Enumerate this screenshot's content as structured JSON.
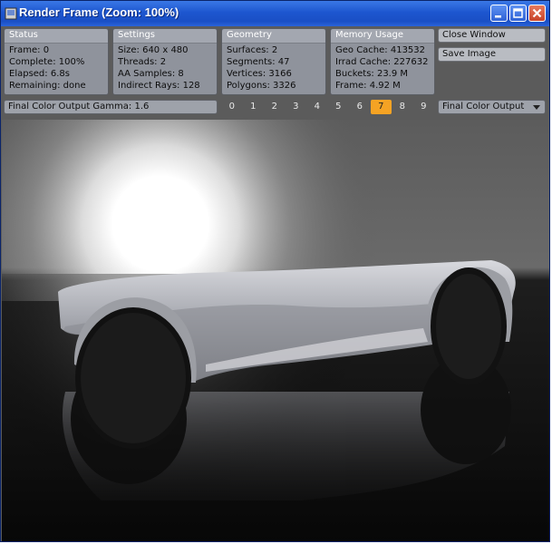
{
  "window": {
    "title": "Render Frame (Zoom: 100%)",
    "controls": [
      "minimize-icon",
      "maximize-icon",
      "close-icon"
    ]
  },
  "panels": {
    "status": {
      "title": "Status",
      "lines": [
        "Frame: 0",
        "Complete: 100%",
        "Elapsed: 6.8s",
        "Remaining: done"
      ]
    },
    "settings": {
      "title": "Settings",
      "lines": [
        "Size: 640 x 480",
        "Threads: 2",
        "AA Samples: 8",
        "Indirect Rays: 128"
      ]
    },
    "geometry": {
      "title": "Geometry",
      "lines": [
        "Surfaces: 2",
        "Segments: 47",
        "Vertices: 3166",
        "Polygons: 3326"
      ]
    },
    "memory": {
      "title": "Memory Usage",
      "lines": [
        "Geo Cache: 413532",
        "Irrad Cache: 227632",
        "Buckets: 23.9 M",
        "Frame: 4.92 M"
      ]
    }
  },
  "buttons": {
    "close": "Close Window",
    "save": "Save Image"
  },
  "gamma": {
    "label": "Final Color Output Gamma: 1.6"
  },
  "buffers": {
    "items": [
      "0",
      "1",
      "2",
      "3",
      "4",
      "5",
      "6",
      "7",
      "8",
      "9"
    ],
    "selected": "7"
  },
  "output_select": {
    "value": "Final Color Output"
  },
  "colors": {
    "accent": "#f5a324",
    "titlebar": "#1d56cf",
    "panel": "#8f939c"
  }
}
